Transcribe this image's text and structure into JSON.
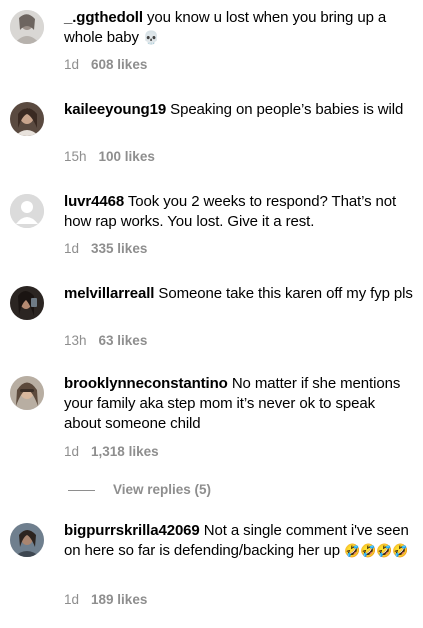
{
  "comments": [
    {
      "username": "_.ggthedoll",
      "text": "you know u lost when you bring up a whole baby",
      "emoji": "💀",
      "time": "1d",
      "likes": "608 likes"
    },
    {
      "username": "kaileeyoung19",
      "text": "Speaking on people’s babies is wild",
      "emoji": "",
      "time": "15h",
      "likes": "100 likes"
    },
    {
      "username": "luvr4468",
      "text": "Took you 2 weeks to respond? That’s not how rap works. You lost. Give it a rest.",
      "emoji": "",
      "time": "1d",
      "likes": "335 likes"
    },
    {
      "username": "melvillarreall",
      "text": "Someone take this karen off my fyp pls",
      "emoji": "",
      "time": "13h",
      "likes": "63 likes"
    },
    {
      "username": "brooklynneconstantino",
      "text": "No matter if she mentions your family aka step mom it’s never ok to speak about someone child",
      "emoji": "",
      "time": "1d",
      "likes": "1,318 likes"
    },
    {
      "username": "bigpurrskrilla42069",
      "text": "Not a single comment i've seen on here so far is defending/backing her up",
      "emoji": "🤣🤣🤣🤣",
      "time": "1d",
      "likes": "189 likes"
    }
  ],
  "view_replies": "View replies (5)",
  "colors": {
    "meta": "#8e8e8e",
    "text": "#000000",
    "background": "#ffffff"
  }
}
